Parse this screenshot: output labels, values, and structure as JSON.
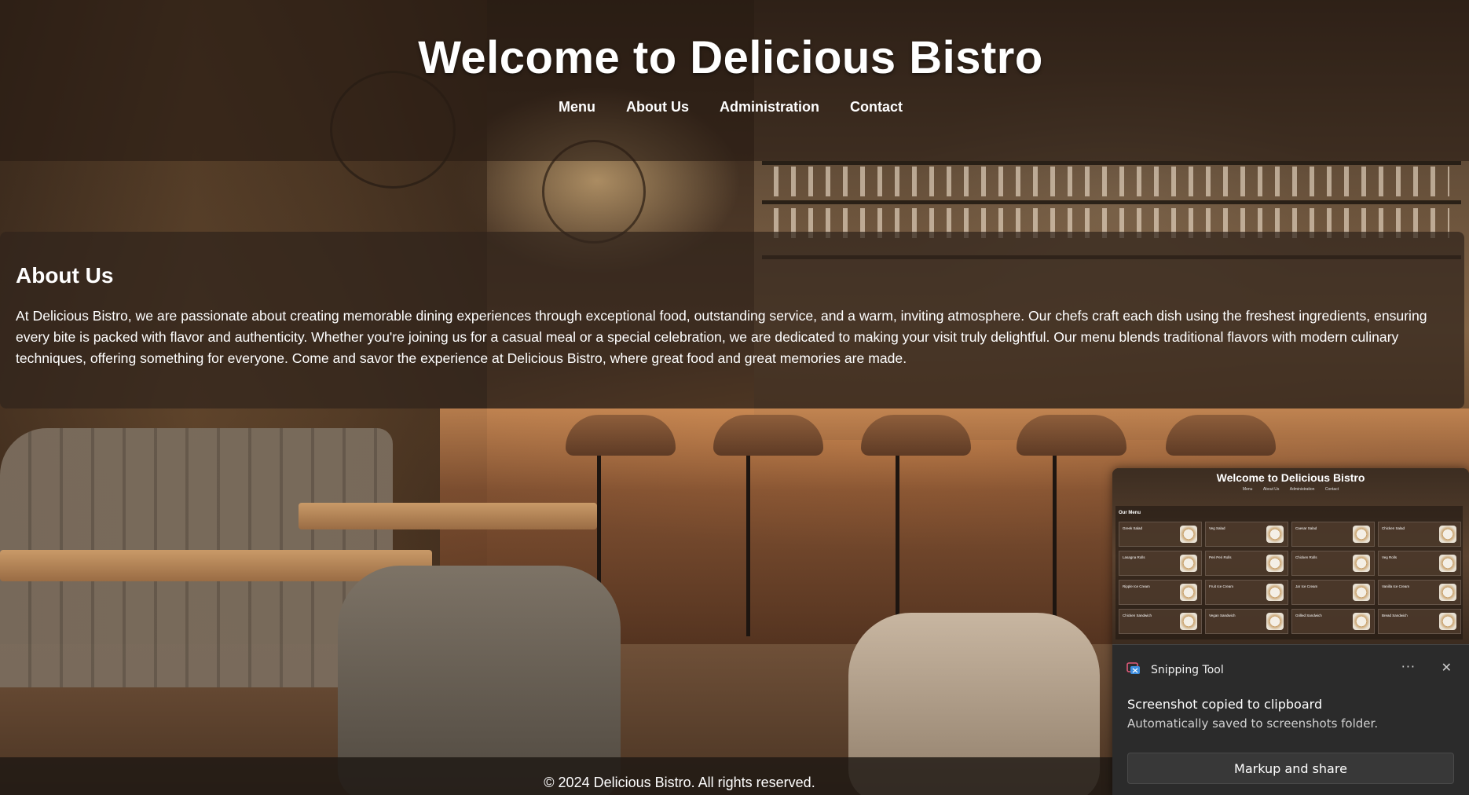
{
  "site": {
    "title": "Welcome to Delicious Bistro",
    "nav": [
      "Menu",
      "About Us",
      "Administration",
      "Contact"
    ]
  },
  "about": {
    "heading": "About Us",
    "text": "At Delicious Bistro, we are passionate about creating memorable dining experiences through exceptional food, outstanding service, and a warm, inviting atmosphere. Our chefs craft each dish using the freshest ingredients, ensuring every bite is packed with flavor and authenticity. Whether you're joining us for a casual meal or a special celebration, we are dedicated to making your visit truly delightful. Our menu blends traditional flavors with modern culinary techniques, offering something for everyone. Come and savor the experience at Delicious Bistro, where great food and great memories are made."
  },
  "footer": {
    "text": "© 2024 Delicious Bistro. All rights reserved."
  },
  "toast": {
    "app_name": "Snipping Tool",
    "more_label": "···",
    "close_label": "✕",
    "title": "Screenshot copied to clipboard",
    "subtitle": "Automatically saved to screenshots folder.",
    "button_label": "Markup and share",
    "icon": "snipping-tool-icon",
    "preview": {
      "title": "Welcome to Delicious Bistro",
      "nav": [
        "Menu",
        "About Us",
        "Administration",
        "Contact"
      ],
      "menu_heading": "Our Menu",
      "items": [
        "Greek Salad",
        "Veg Salad",
        "Caesar Salad",
        "Chicken Salad",
        "Lasagna Rolls",
        "Peri Peri Rolls",
        "Chicken Rolls",
        "Veg Rolls",
        "Ripple Ice Cream",
        "Fruit Ice Cream",
        "Jar Ice Cream",
        "Vanilla Ice Cream",
        "Chicken Sandwich",
        "Vegan Sandwich",
        "Grilled Sandwich",
        "Bread Sandwich"
      ]
    }
  },
  "colors": {
    "header_overlay": "#281c14",
    "panel_overlay": "#30241c",
    "toast_bg": "#2b2b2b",
    "text": "#ffffff"
  }
}
